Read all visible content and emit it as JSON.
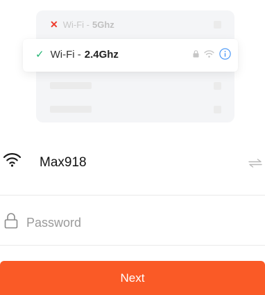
{
  "illustration": {
    "bad_network": {
      "prefix": "Wi-Fi - ",
      "band": "5Ghz",
      "status_icon": "x-icon"
    },
    "good_network": {
      "prefix": "Wi-Fi - ",
      "band": "2.4Ghz",
      "status_icon": "check-icon"
    }
  },
  "wifi": {
    "ssid": "Max918"
  },
  "password": {
    "placeholder": "Password",
    "value": ""
  },
  "next_button": {
    "label": "Next"
  },
  "colors": {
    "accent": "#fa5a26",
    "success": "#22b573",
    "error": "#ee3b2c",
    "info": "#3b8ff6"
  }
}
